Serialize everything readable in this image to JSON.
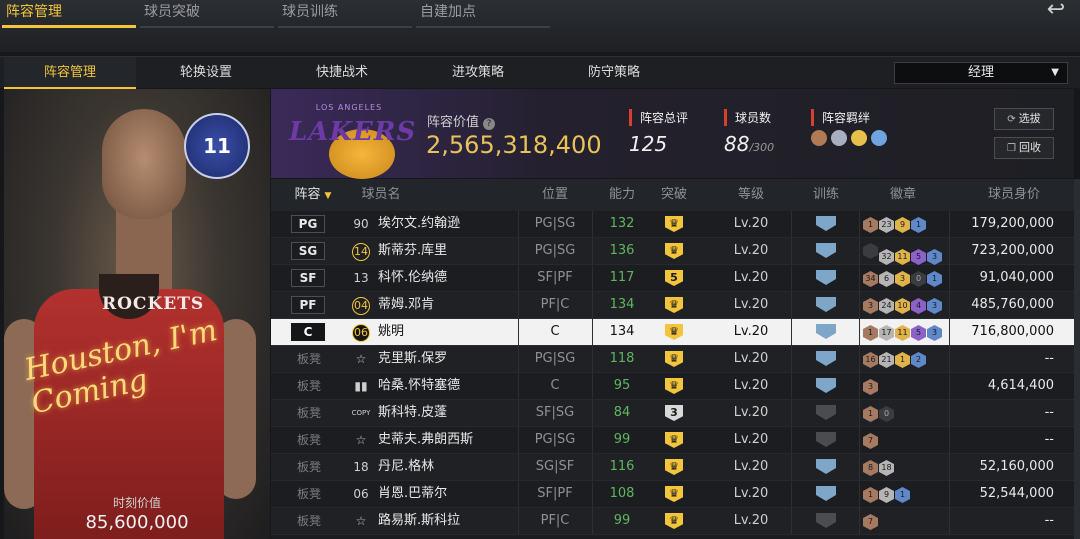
{
  "top_tabs": [
    "阵容管理",
    "球员突破",
    "球员训练",
    "自建加点"
  ],
  "back_icon": "↩",
  "sub_tabs": [
    "阵容管理",
    "轮换设置",
    "快捷战术",
    "进攻策略",
    "防守策略"
  ],
  "role_select": {
    "value": "经理"
  },
  "player_card": {
    "script_text": "Houston, I'm Coming",
    "jersey_text": "ROCKETS",
    "logo_text": "11",
    "value_label": "时刻价值",
    "value": "85,600,000"
  },
  "team": {
    "logo_small": "LOS ANGELES",
    "logo_text": "LAKERS",
    "value_label": "阵容价值",
    "value": "2,565,318,400",
    "stats": {
      "rating_label": "阵容总评",
      "rating": "125",
      "players_label": "球员数",
      "players": "88",
      "players_max": "/300",
      "bonds_label": "阵容羁绊"
    },
    "buttons": {
      "filter": "选拔",
      "recycle": "回收"
    }
  },
  "table": {
    "headers": [
      "阵容",
      "球员名",
      "位置",
      "能力",
      "突破",
      "等级",
      "训练",
      "徽章",
      "球员身价"
    ],
    "rows": [
      {
        "slot": "PG",
        "num": "90",
        "name": "埃尔文.约翰逊",
        "pos": "PG|SG",
        "ability": "132",
        "break": "♛",
        "level": "Lv.20",
        "train": "♛",
        "badges": [
          [
            "1",
            "bronze"
          ],
          [
            "23",
            "silver"
          ],
          [
            "9",
            "gold"
          ],
          [
            "1",
            "blue"
          ]
        ],
        "salary": "179,200,000"
      },
      {
        "slot": "SG",
        "num": "14",
        "name": "斯蒂芬.库里",
        "pos": "PG|SG",
        "ability": "136",
        "break": "♛",
        "level": "Lv.20",
        "train": "♛",
        "badges": [
          [
            "",
            "dark"
          ],
          [
            "32",
            "silver"
          ],
          [
            "11",
            "gold"
          ],
          [
            "5",
            "purple"
          ],
          [
            "3",
            "blue"
          ]
        ],
        "salary": "723,200,000"
      },
      {
        "slot": "SF",
        "num": "13",
        "name": "科怀.伦纳德",
        "pos": "SF|PF",
        "ability": "117",
        "break": "5",
        "level": "Lv.20",
        "train": "♛",
        "badges": [
          [
            "34",
            "bronze"
          ],
          [
            "6",
            "silver"
          ],
          [
            "3",
            "gold"
          ],
          [
            "0",
            "dark"
          ],
          [
            "1",
            "blue"
          ]
        ],
        "salary": "91,040,000"
      },
      {
        "slot": "PF",
        "num": "04",
        "name": "蒂姆.邓肯",
        "pos": "PF|C",
        "ability": "134",
        "break": "♛",
        "level": "Lv.20",
        "train": "♛",
        "badges": [
          [
            "3",
            "bronze"
          ],
          [
            "24",
            "silver"
          ],
          [
            "10",
            "gold"
          ],
          [
            "4",
            "purple"
          ],
          [
            "3",
            "blue"
          ]
        ],
        "salary": "485,760,000"
      },
      {
        "slot": "C",
        "num": "06",
        "name": "姚明",
        "pos": "C",
        "ability": "134",
        "break": "♛",
        "level": "Lv.20",
        "train": "♛",
        "badges": [
          [
            "1",
            "bronze"
          ],
          [
            "17",
            "silver"
          ],
          [
            "11",
            "gold"
          ],
          [
            "5",
            "purple"
          ],
          [
            "3",
            "blue"
          ]
        ],
        "salary": "716,800,000"
      },
      {
        "slot": "板凳",
        "num": "☆",
        "name": "克里斯.保罗",
        "pos": "PG|SG",
        "ability": "118",
        "break": "♛",
        "level": "Lv.20",
        "train": "♛",
        "badges": [
          [
            "16",
            "bronze"
          ],
          [
            "21",
            "silver"
          ],
          [
            "1",
            "gold"
          ],
          [
            "2",
            "blue"
          ]
        ],
        "salary": "--"
      },
      {
        "slot": "板凳",
        "num": "▮▮",
        "name": "哈桑.怀特塞德",
        "pos": "C",
        "ability": "95",
        "break": "♛",
        "level": "Lv.20",
        "train": "♛",
        "badges": [
          [
            "3",
            "bronze"
          ]
        ],
        "salary": "4,614,400"
      },
      {
        "slot": "板凳",
        "num": "COPY",
        "name": "斯科特.皮蓬",
        "pos": "SF|SG",
        "ability": "84",
        "break": "3",
        "level": "Lv.20",
        "train": "dim",
        "badges": [
          [
            "1",
            "bronze"
          ],
          [
            "0",
            "dark"
          ]
        ],
        "salary": "--"
      },
      {
        "slot": "板凳",
        "num": "☆",
        "name": "史蒂夫.弗朗西斯",
        "pos": "PG|SG",
        "ability": "99",
        "break": "♛",
        "level": "Lv.20",
        "train": "dim",
        "badges": [
          [
            "7",
            "bronze"
          ]
        ],
        "salary": "--"
      },
      {
        "slot": "板凳",
        "num": "18",
        "name": "丹尼.格林",
        "pos": "SG|SF",
        "ability": "116",
        "break": "♛",
        "level": "Lv.20",
        "train": "♛",
        "badges": [
          [
            "8",
            "bronze"
          ],
          [
            "18",
            "silver"
          ]
        ],
        "salary": "52,160,000"
      },
      {
        "slot": "板凳",
        "num": "06",
        "name": "肖恩.巴蒂尔",
        "pos": "SF|PF",
        "ability": "108",
        "break": "♛",
        "level": "Lv.20",
        "train": "♛",
        "badges": [
          [
            "1",
            "bronze"
          ],
          [
            "9",
            "silver"
          ],
          [
            "1",
            "blue"
          ]
        ],
        "salary": "52,544,000"
      },
      {
        "slot": "板凳",
        "num": "☆",
        "name": "路易斯.斯科拉",
        "pos": "PF|C",
        "ability": "99",
        "break": "♛",
        "level": "Lv.20",
        "train": "dim",
        "badges": [
          [
            "7",
            "bronze"
          ]
        ],
        "salary": "--"
      }
    ]
  },
  "colors": {
    "accent": "#f2c53d",
    "ability_green": "#5fb65f",
    "header_purple": "#3a2a5a"
  }
}
